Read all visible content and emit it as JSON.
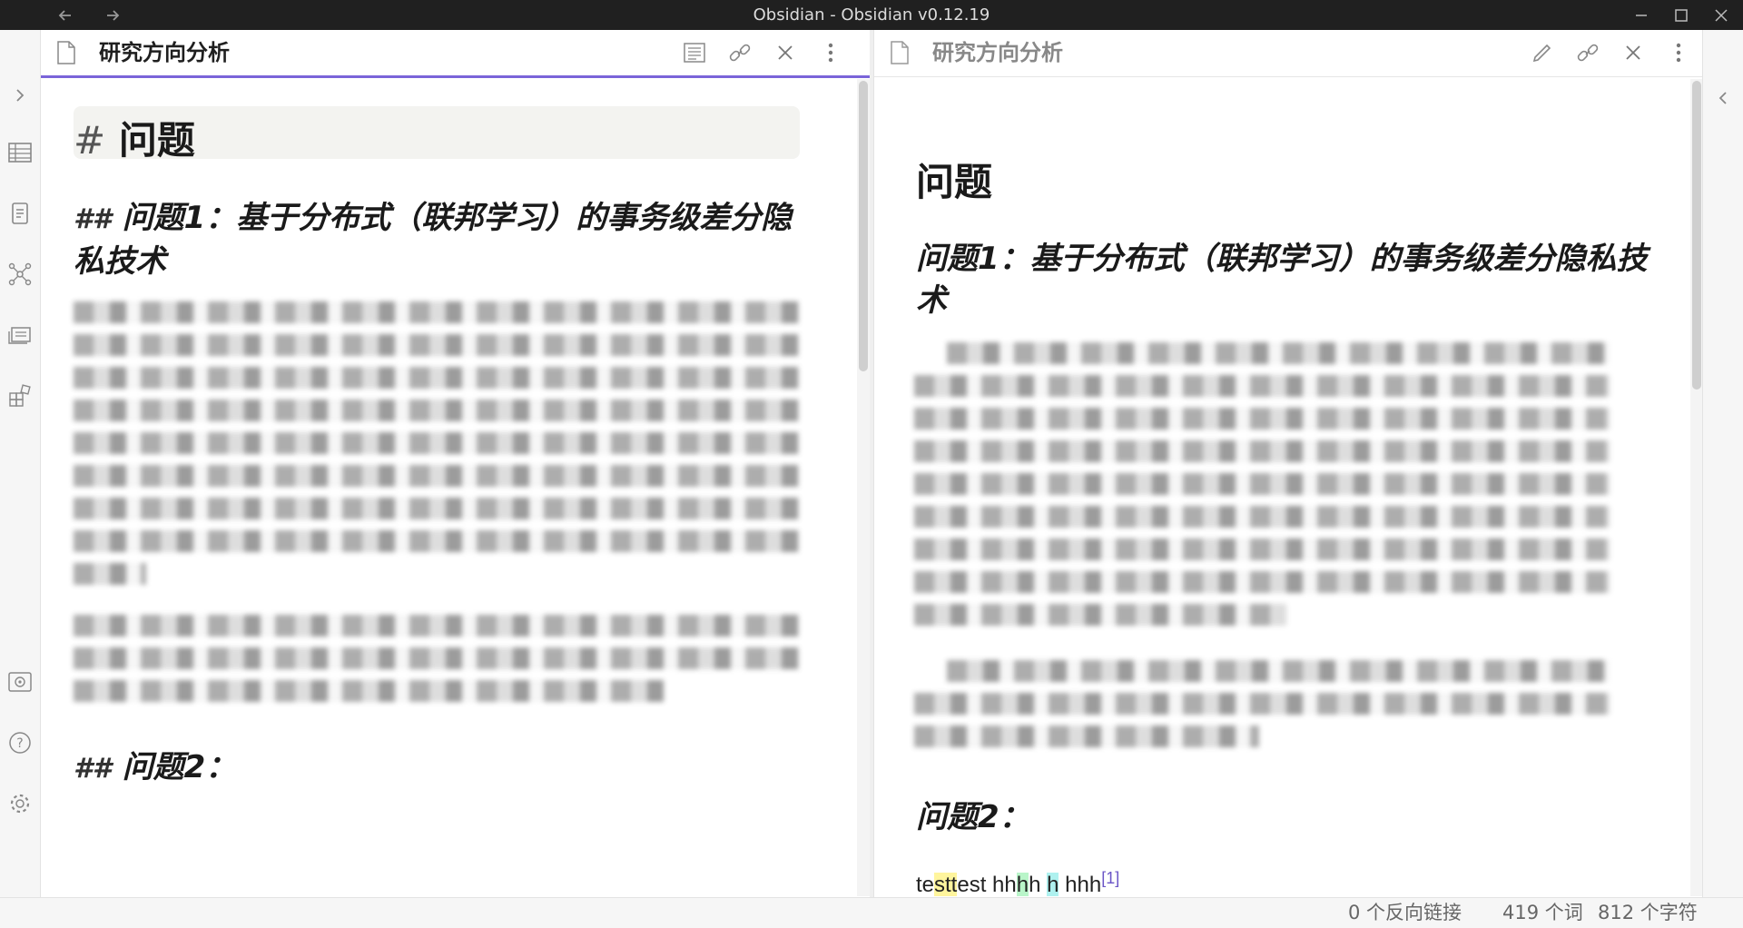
{
  "window": {
    "title": "Obsidian - Obsidian v0.12.19",
    "back_icon": "arrow-left-icon",
    "forward_icon": "arrow-right-icon"
  },
  "ribbon": {
    "items": [
      "chevron-right-icon",
      "table-icon",
      "file-list-icon",
      "graph-icon",
      "cards-icon",
      "plugins-icon",
      "vault-icon",
      "help-icon",
      "settings-icon"
    ]
  },
  "left_pane": {
    "title": "研究方向分析",
    "mode": "edit",
    "editor": {
      "h1_marker": "#",
      "h1_text": "问题",
      "h2a_marker": "##",
      "h2a_text": "问题1：基于分布式（联邦学习）的事务级差分隐私技术",
      "h2b_marker": "##",
      "h2b_text": "问题2："
    }
  },
  "right_pane": {
    "title": "研究方向分析",
    "mode": "preview",
    "preview": {
      "h1_text": "问题",
      "h2a_text": "问题1：基于分布式（联邦学习）的事务级差分隐私技术",
      "h2b_text": "问题2：",
      "line_a": "te",
      "line_hl1": "stt",
      "line_b": "est hh",
      "line_hl2": "h",
      "line_c": "h ",
      "line_hl3": "h",
      "line_d": " hhh",
      "footnote": "[1]"
    }
  },
  "status_bar": {
    "backlinks": "0 个反向链接",
    "words": "419 个词",
    "chars": "812 个字符"
  },
  "colors": {
    "accent": "#7a64d9",
    "highlight_yellow": "#fff59d",
    "highlight_green": "#b9f5c9",
    "highlight_cyan": "#aef1ef"
  }
}
